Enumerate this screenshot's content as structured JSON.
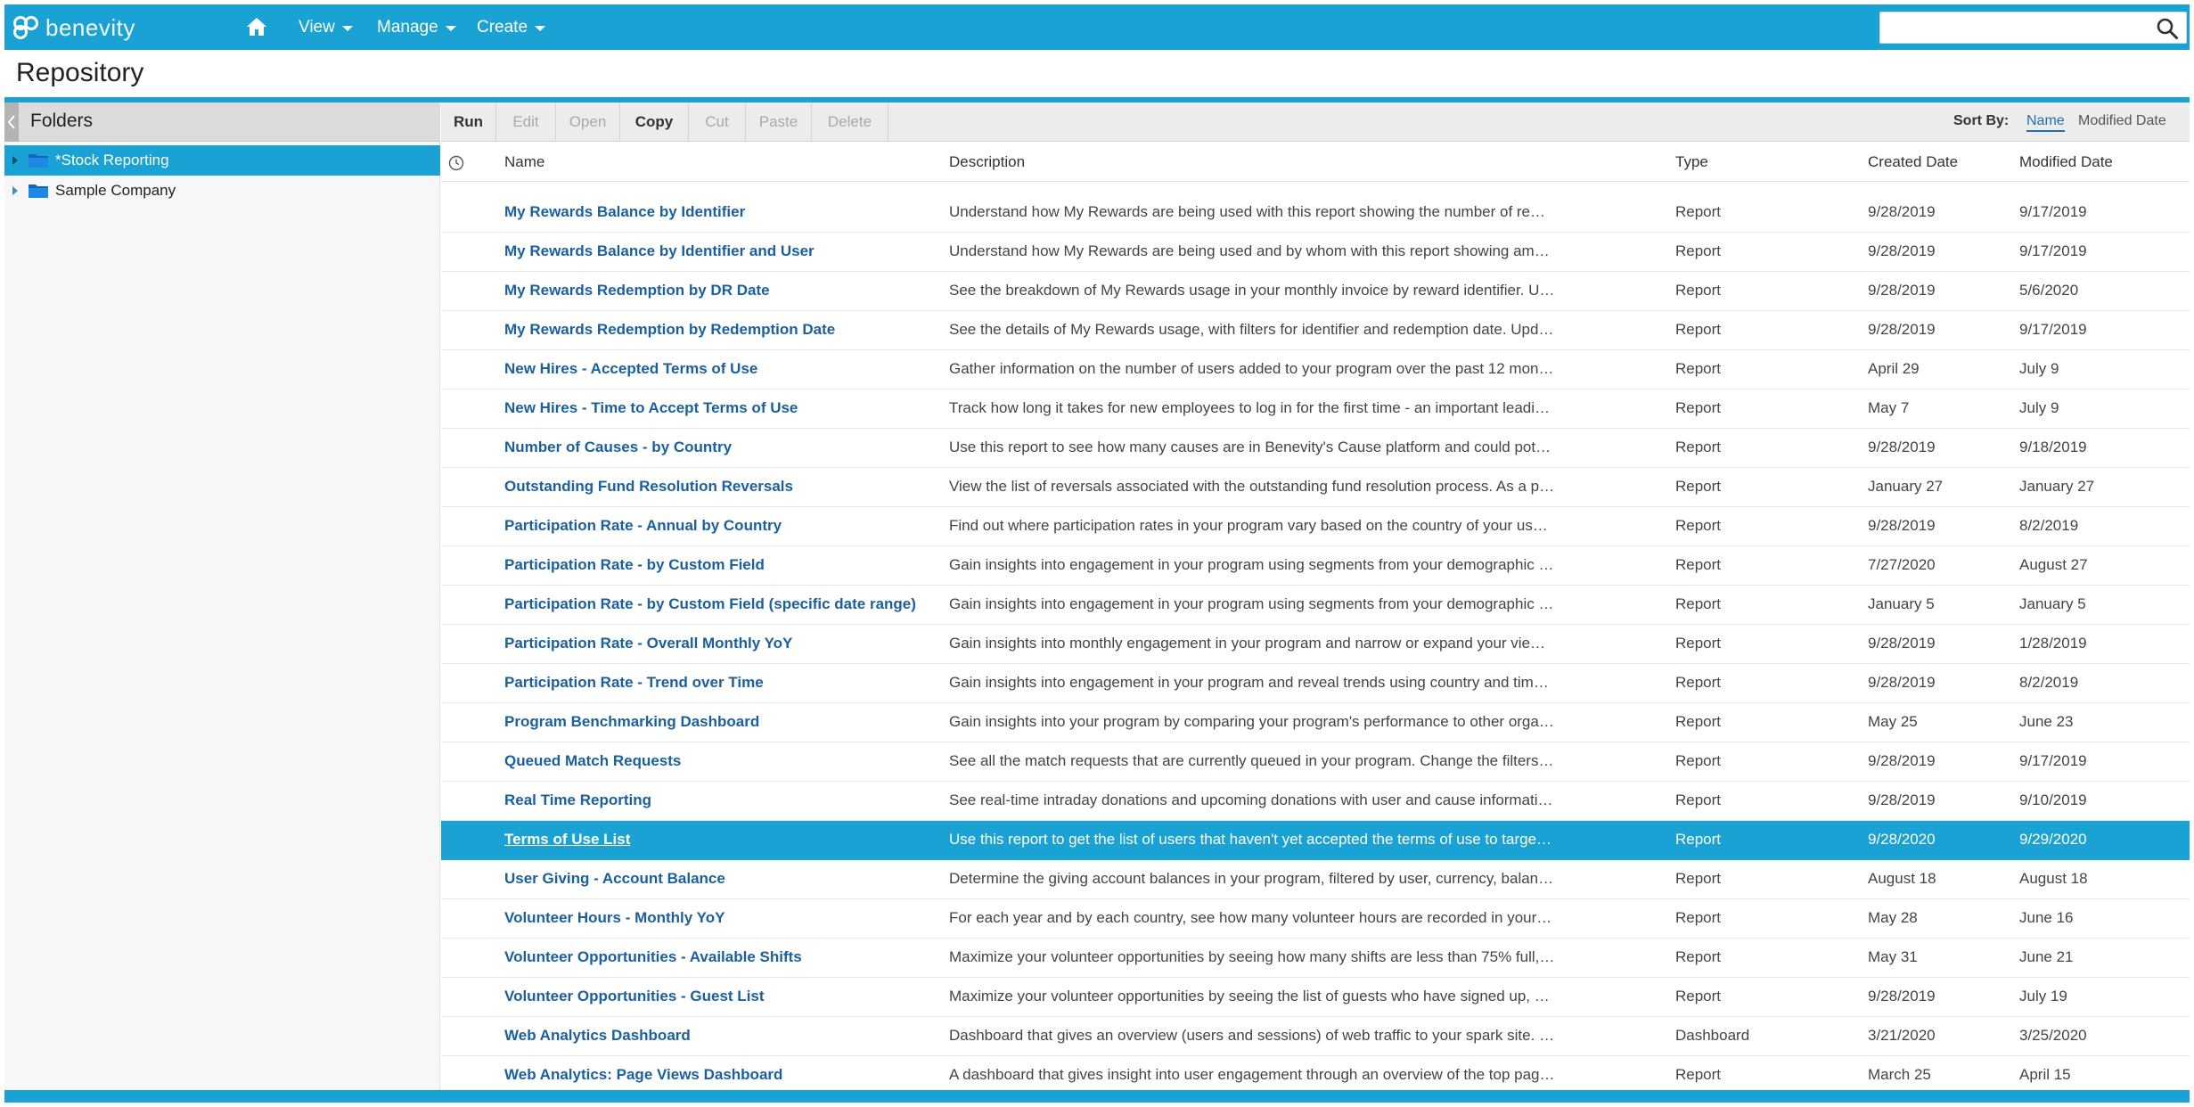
{
  "brand": {
    "name": "benevity",
    "color": "#1aa2d4"
  },
  "topnav": {
    "home_icon": "home-icon",
    "menus": [
      {
        "label": "View"
      },
      {
        "label": "Manage"
      },
      {
        "label": "Create"
      }
    ],
    "search": {
      "value": "",
      "placeholder": "",
      "icon": "search-icon"
    }
  },
  "page": {
    "title": "Repository"
  },
  "folders": {
    "header": "Folders",
    "items": [
      {
        "label": "*Stock Reporting",
        "selected": true
      },
      {
        "label": "Sample Company",
        "selected": false
      }
    ]
  },
  "toolbar": {
    "buttons": [
      {
        "label": "Run",
        "enabled": true
      },
      {
        "label": "Edit",
        "enabled": false
      },
      {
        "label": "Open",
        "enabled": false
      },
      {
        "label": "Copy",
        "enabled": true
      },
      {
        "label": "Cut",
        "enabled": false
      },
      {
        "label": "Paste",
        "enabled": false
      },
      {
        "label": "Delete",
        "enabled": false
      }
    ],
    "sort_by": {
      "label": "Sort By:",
      "options": [
        "Name",
        "Modified Date"
      ],
      "active": "Name"
    }
  },
  "table": {
    "columns": {
      "name": "Name",
      "description": "Description",
      "type": "Type",
      "created": "Created Date",
      "modified": "Modified Date"
    },
    "rows": [
      {
        "name": "My Rewards Balance by Identifier",
        "description": "Understand how My Rewards are being used with this report showing the number of rew…",
        "type": "Report",
        "created": "9/28/2019",
        "modified": "9/17/2019"
      },
      {
        "name": "My Rewards Balance by Identifier and User",
        "description": "Understand how My Rewards are being used and by whom with this report showing amo…",
        "type": "Report",
        "created": "9/28/2019",
        "modified": "9/17/2019"
      },
      {
        "name": "My Rewards Redemption by DR Date",
        "description": "See the breakdown of My Rewards usage in your monthly invoice by reward identifier. Up…",
        "type": "Report",
        "created": "9/28/2019",
        "modified": "5/6/2020"
      },
      {
        "name": "My Rewards Redemption by Redemption Date",
        "description": "See the details of My Rewards usage, with filters for identifier and redemption date. Upda…",
        "type": "Report",
        "created": "9/28/2019",
        "modified": "9/17/2019"
      },
      {
        "name": "New Hires - Accepted Terms of Use",
        "description": "Gather information on the number of users added to your program over the past 12 mont…",
        "type": "Report",
        "created": "April 29",
        "modified": "July 9"
      },
      {
        "name": "New Hires - Time to Accept Terms of Use",
        "description": "Track how long it takes for new employees to log in for the first time - an important leadi…",
        "type": "Report",
        "created": "May 7",
        "modified": "July 9"
      },
      {
        "name": "Number of Causes - by Country",
        "description": "Use this report to see how many causes are in Benevity's Cause platform and could pote…",
        "type": "Report",
        "created": "9/28/2019",
        "modified": "9/18/2019"
      },
      {
        "name": "Outstanding Fund Resolution Reversals",
        "description": "View the list of reversals associated with the outstanding fund resolution process. As a pa…",
        "type": "Report",
        "created": "January 27",
        "modified": "January 27"
      },
      {
        "name": "Participation Rate - Annual by Country",
        "description": "Find out where participation rates in your program vary based on the country of your use…",
        "type": "Report",
        "created": "9/28/2019",
        "modified": "8/2/2019"
      },
      {
        "name": "Participation Rate - by Custom Field",
        "description": "Gain insights into engagement in your program using segments from your demographic f…",
        "type": "Report",
        "created": "7/27/2020",
        "modified": "August 27"
      },
      {
        "name": "Participation Rate - by Custom Field (specific date range)",
        "description": "Gain insights into engagement in your program using segments from your demographic f…",
        "type": "Report",
        "created": "January 5",
        "modified": "January 5"
      },
      {
        "name": "Participation Rate - Overall Monthly YoY",
        "description": "Gain insights into monthly engagement in your program and narrow or expand your view…",
        "type": "Report",
        "created": "9/28/2019",
        "modified": "1/28/2019"
      },
      {
        "name": "Participation Rate - Trend over Time",
        "description": "Gain insights into engagement in your program and reveal trends using country and time…",
        "type": "Report",
        "created": "9/28/2019",
        "modified": "8/2/2019"
      },
      {
        "name": "Program Benchmarking Dashboard",
        "description": "Gain insights into your program by comparing your program's performance to other orga…",
        "type": "Report",
        "created": "May 25",
        "modified": "June 23"
      },
      {
        "name": "Queued Match Requests",
        "description": "See all the match requests that are currently queued in your program. Change the filters …",
        "type": "Report",
        "created": "9/28/2019",
        "modified": "9/17/2019"
      },
      {
        "name": "Real Time Reporting",
        "description": "See real-time intraday donations and upcoming donations with user and cause informati…",
        "type": "Report",
        "created": "9/28/2019",
        "modified": "9/10/2019"
      },
      {
        "name": "Terms of Use List",
        "description": "Use this report to get the list of users that haven't yet accepted the terms of use to target …",
        "type": "Report",
        "created": "9/28/2020",
        "modified": "9/29/2020",
        "selected": true
      },
      {
        "name": "User Giving - Account Balance",
        "description": "Determine the giving account balances in your program, filtered by user, currency, balan…",
        "type": "Report",
        "created": "August 18",
        "modified": "August 18"
      },
      {
        "name": "Volunteer Hours - Monthly YoY",
        "description": "For each year and by each country, see how many volunteer hours are recorded in your p…",
        "type": "Report",
        "created": "May 28",
        "modified": "June 16"
      },
      {
        "name": "Volunteer Opportunities - Available Shifts",
        "description": "Maximize your volunteer opportunities by seeing how many shifts are less than 75% full, …",
        "type": "Report",
        "created": "May 31",
        "modified": "June 21"
      },
      {
        "name": "Volunteer Opportunities - Guest List",
        "description": "Maximize your volunteer opportunities by seeing the list of guests who have signed up, w…",
        "type": "Report",
        "created": "9/28/2019",
        "modified": "July 19"
      },
      {
        "name": "Web Analytics Dashboard",
        "description": "Dashboard that gives an overview (users and sessions) of web traffic to your spark site. U…",
        "type": "Dashboard",
        "created": "3/21/2020",
        "modified": "3/25/2020"
      },
      {
        "name": "Web Analytics: Page Views Dashboard",
        "description": "A dashboard that gives insight into user engagement through an overview of the top pag…",
        "type": "Report",
        "created": "March 25",
        "modified": "April 15"
      }
    ]
  }
}
